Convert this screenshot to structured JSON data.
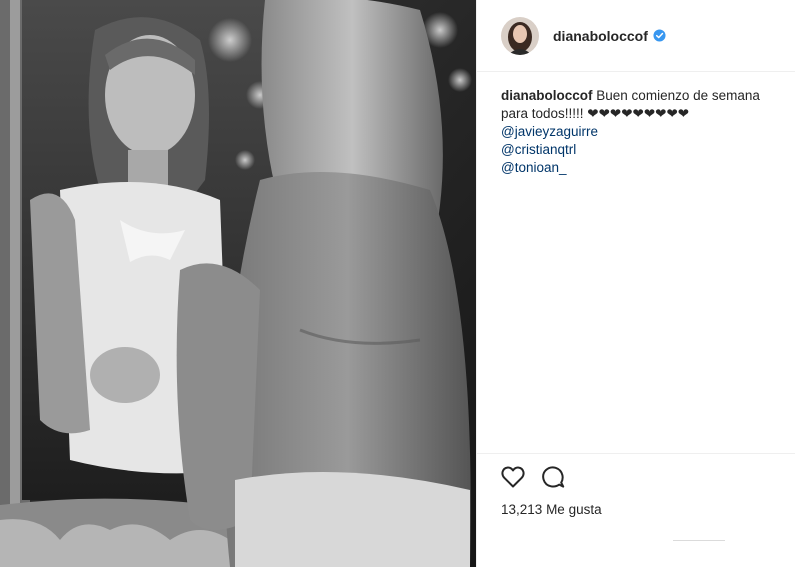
{
  "post": {
    "username": "dianaboloccof",
    "verified": true,
    "caption_user": "dianaboloccof",
    "caption_text": "Buen comienzo de semana para todos!!!!! ❤❤❤❤❤❤❤❤❤",
    "mentions": [
      "@javieyzaguirre",
      "@cristianqtrl",
      "@tonioan_"
    ],
    "likes_count": "13,213",
    "likes_label": "Me gusta"
  },
  "icons": {
    "like": "heart-outline-icon",
    "comment": "comment-bubble-icon",
    "verified": "verified-badge-icon"
  },
  "colors": {
    "verified_blue": "#3897f0",
    "mention_link": "#003569",
    "text": "#262626",
    "divider": "#efefef"
  }
}
